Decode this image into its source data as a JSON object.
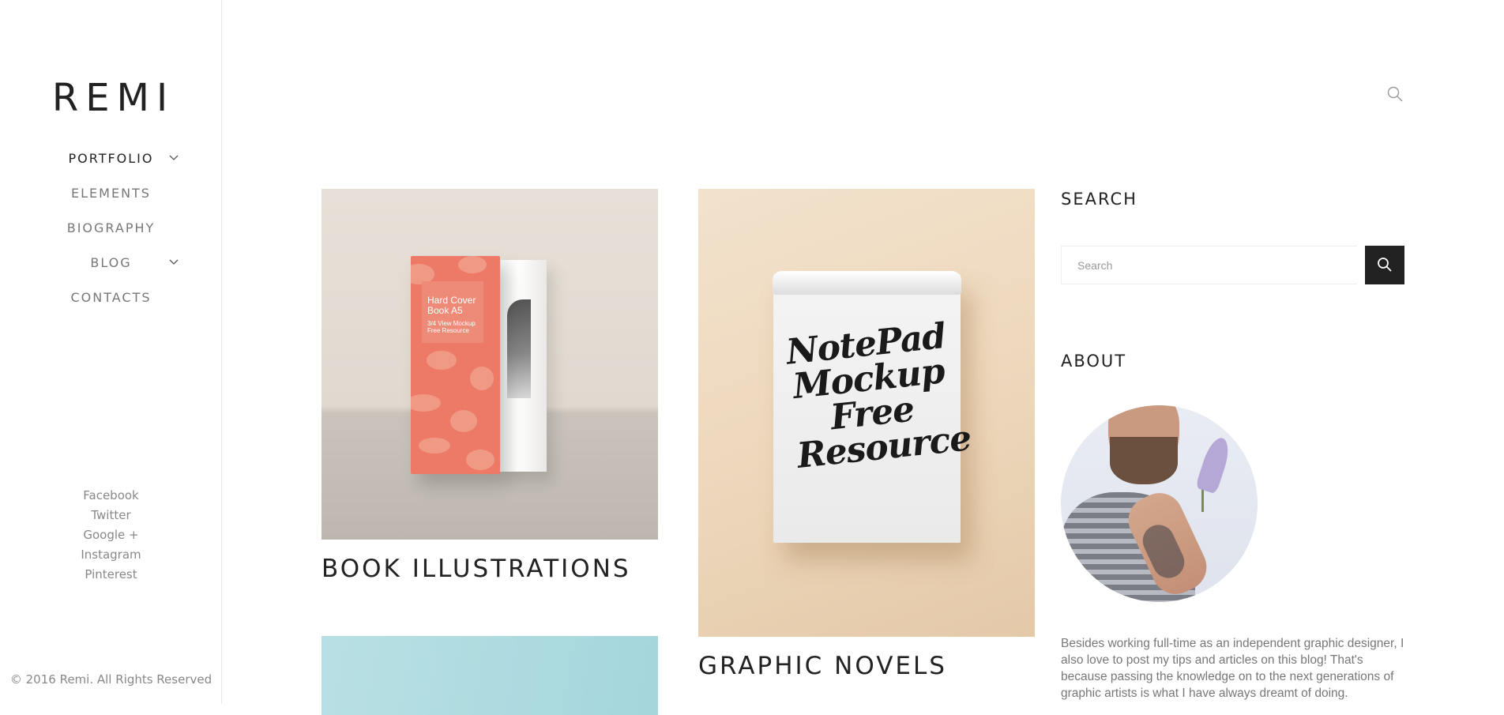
{
  "brand": {
    "logo": "REMI"
  },
  "nav": {
    "items": [
      {
        "label": "PORTFOLIO",
        "active": true,
        "has_submenu": true
      },
      {
        "label": "ELEMENTS",
        "active": false,
        "has_submenu": false
      },
      {
        "label": "BIOGRAPHY",
        "active": false,
        "has_submenu": false
      },
      {
        "label": "BLOG",
        "active": false,
        "has_submenu": true
      },
      {
        "label": "CONTACTS",
        "active": false,
        "has_submenu": false
      }
    ]
  },
  "social": [
    "Facebook",
    "Twitter",
    "Google +",
    "Instagram",
    "Pinterest"
  ],
  "footer": {
    "copyright": "© 2016 Remi. All Rights Reserved"
  },
  "header": {
    "search_icon": "search-icon"
  },
  "portfolio": {
    "items": [
      {
        "title": "BOOK ILLUSTRATIONS",
        "image_text": [
          "Hard Cover",
          "Book A5",
          "3/4 View Mockup",
          "Free Resource"
        ]
      },
      {
        "title": "GRAPHIC NOVELS",
        "image_text": [
          "NotePad",
          "Mockup",
          "Free",
          "Resource"
        ]
      },
      {
        "title": ""
      }
    ]
  },
  "sidebar_widgets": {
    "search": {
      "title": "SEARCH",
      "placeholder": "Search",
      "button_icon": "search-icon"
    },
    "about": {
      "title": "ABOUT",
      "text": "Besides working full-time as an independent graphic designer, I also love to post my tips and articles on this blog! That's because passing the knowledge on to the next generations of graphic artists is what I have always dreamt of doing."
    }
  },
  "colors": {
    "accent_dark": "#222222",
    "muted_text": "#777777",
    "book_cover": "#ec7a67",
    "notepad_bg": "#eed8bd",
    "teal_card": "#a4d6dc"
  }
}
